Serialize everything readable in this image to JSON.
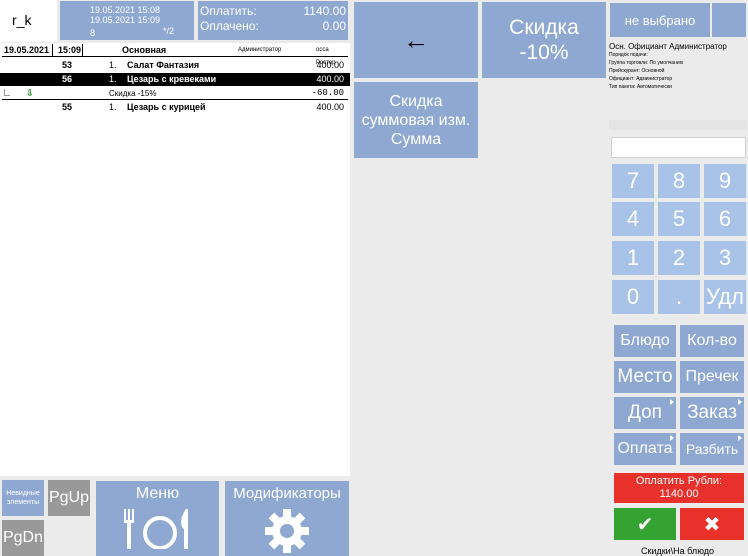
{
  "logo": "r_k",
  "header": {
    "opened_time": "19.05.2021 15:08",
    "current_time": "19.05.2021 15:09",
    "table_no": "8",
    "guests": "*/2",
    "to_pay_label": "Оплатить:",
    "to_pay_value": "1140.00",
    "paid_label": "Оплачено:",
    "paid_value": "0.00"
  },
  "order_header": {
    "date": "19.05.2021",
    "time": "15:09",
    "group": "Основная",
    "waiter": "Администратор",
    "station": "осса Ростор"
  },
  "order_rows": [
    {
      "code": "53",
      "qty": "1.",
      "name": "Салат Фантазия",
      "price": "400.00"
    },
    {
      "code": "56",
      "qty": "1.",
      "name": "Цезарь с кревеками",
      "price": "400.00"
    },
    {
      "code": "55",
      "qty": "1.",
      "name": "Цезарь с курицей",
      "price": "400.00"
    }
  ],
  "discount_row": {
    "name": "Скидка -15%",
    "price": "-60.00"
  },
  "actions": {
    "back_arrow": "←",
    "discount10": "Скидка -10%",
    "discount_sum_1": "Скидка",
    "discount_sum_2": "суммовая изм.",
    "discount_sum_3": "Сумма"
  },
  "info": {
    "not_selected": "не выбрано",
    "waiter_line": "Осн. Официант Администратор",
    "serve_order": "Порядок подачи:",
    "trade_group": "Группа торговли: По умолчанию",
    "price_list": "Прейскурант: Основной",
    "officiant": "Официант: Администратор",
    "pay_type": "Тип пакета: Автоматически"
  },
  "numpad": [
    "7",
    "8",
    "9",
    "4",
    "5",
    "6",
    "1",
    "2",
    "3",
    "0",
    ".",
    "Удл"
  ],
  "commands": {
    "dish": "Блюдо",
    "qty": "Кол-во",
    "place": "Место",
    "precheck": "Пречек",
    "add": "Доп",
    "order": "Заказ",
    "payment": "Оплата",
    "split": "Разбить"
  },
  "pay_button": {
    "line1": "Оплатить Рубли:",
    "line2": "1140.00"
  },
  "confirm_glyph": "✔",
  "cancel_glyph": "✖",
  "status": "Скидки\\На блюдо",
  "bottom": {
    "hidden_items": "Невидные элементы",
    "pgup": "PgUp",
    "pgdn": "PgDn",
    "menu": "Меню",
    "modifiers": "Модификаторы"
  },
  "colors": {
    "tile": "#8fa8d2",
    "numpad": "#a9c2e8",
    "pay": "#e8312a",
    "ok": "#35a332",
    "cancel": "#e8312a"
  }
}
